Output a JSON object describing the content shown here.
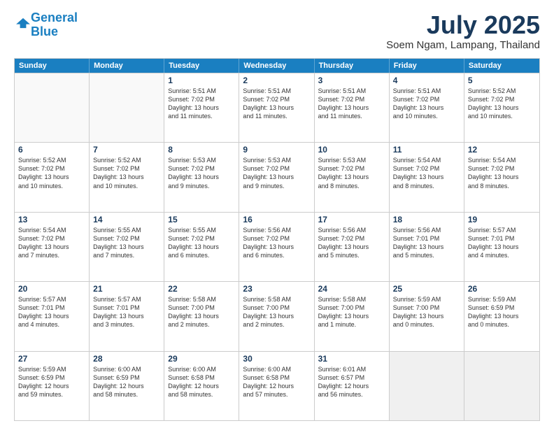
{
  "logo": {
    "line1": "General",
    "line2": "Blue"
  },
  "title": "July 2025",
  "location": "Soem Ngam, Lampang, Thailand",
  "days_of_week": [
    "Sunday",
    "Monday",
    "Tuesday",
    "Wednesday",
    "Thursday",
    "Friday",
    "Saturday"
  ],
  "weeks": [
    [
      {
        "day": "",
        "lines": []
      },
      {
        "day": "",
        "lines": []
      },
      {
        "day": "1",
        "lines": [
          "Sunrise: 5:51 AM",
          "Sunset: 7:02 PM",
          "Daylight: 13 hours",
          "and 11 minutes."
        ]
      },
      {
        "day": "2",
        "lines": [
          "Sunrise: 5:51 AM",
          "Sunset: 7:02 PM",
          "Daylight: 13 hours",
          "and 11 minutes."
        ]
      },
      {
        "day": "3",
        "lines": [
          "Sunrise: 5:51 AM",
          "Sunset: 7:02 PM",
          "Daylight: 13 hours",
          "and 11 minutes."
        ]
      },
      {
        "day": "4",
        "lines": [
          "Sunrise: 5:51 AM",
          "Sunset: 7:02 PM",
          "Daylight: 13 hours",
          "and 10 minutes."
        ]
      },
      {
        "day": "5",
        "lines": [
          "Sunrise: 5:52 AM",
          "Sunset: 7:02 PM",
          "Daylight: 13 hours",
          "and 10 minutes."
        ]
      }
    ],
    [
      {
        "day": "6",
        "lines": [
          "Sunrise: 5:52 AM",
          "Sunset: 7:02 PM",
          "Daylight: 13 hours",
          "and 10 minutes."
        ]
      },
      {
        "day": "7",
        "lines": [
          "Sunrise: 5:52 AM",
          "Sunset: 7:02 PM",
          "Daylight: 13 hours",
          "and 10 minutes."
        ]
      },
      {
        "day": "8",
        "lines": [
          "Sunrise: 5:53 AM",
          "Sunset: 7:02 PM",
          "Daylight: 13 hours",
          "and 9 minutes."
        ]
      },
      {
        "day": "9",
        "lines": [
          "Sunrise: 5:53 AM",
          "Sunset: 7:02 PM",
          "Daylight: 13 hours",
          "and 9 minutes."
        ]
      },
      {
        "day": "10",
        "lines": [
          "Sunrise: 5:53 AM",
          "Sunset: 7:02 PM",
          "Daylight: 13 hours",
          "and 8 minutes."
        ]
      },
      {
        "day": "11",
        "lines": [
          "Sunrise: 5:54 AM",
          "Sunset: 7:02 PM",
          "Daylight: 13 hours",
          "and 8 minutes."
        ]
      },
      {
        "day": "12",
        "lines": [
          "Sunrise: 5:54 AM",
          "Sunset: 7:02 PM",
          "Daylight: 13 hours",
          "and 8 minutes."
        ]
      }
    ],
    [
      {
        "day": "13",
        "lines": [
          "Sunrise: 5:54 AM",
          "Sunset: 7:02 PM",
          "Daylight: 13 hours",
          "and 7 minutes."
        ]
      },
      {
        "day": "14",
        "lines": [
          "Sunrise: 5:55 AM",
          "Sunset: 7:02 PM",
          "Daylight: 13 hours",
          "and 7 minutes."
        ]
      },
      {
        "day": "15",
        "lines": [
          "Sunrise: 5:55 AM",
          "Sunset: 7:02 PM",
          "Daylight: 13 hours",
          "and 6 minutes."
        ]
      },
      {
        "day": "16",
        "lines": [
          "Sunrise: 5:56 AM",
          "Sunset: 7:02 PM",
          "Daylight: 13 hours",
          "and 6 minutes."
        ]
      },
      {
        "day": "17",
        "lines": [
          "Sunrise: 5:56 AM",
          "Sunset: 7:02 PM",
          "Daylight: 13 hours",
          "and 5 minutes."
        ]
      },
      {
        "day": "18",
        "lines": [
          "Sunrise: 5:56 AM",
          "Sunset: 7:01 PM",
          "Daylight: 13 hours",
          "and 5 minutes."
        ]
      },
      {
        "day": "19",
        "lines": [
          "Sunrise: 5:57 AM",
          "Sunset: 7:01 PM",
          "Daylight: 13 hours",
          "and 4 minutes."
        ]
      }
    ],
    [
      {
        "day": "20",
        "lines": [
          "Sunrise: 5:57 AM",
          "Sunset: 7:01 PM",
          "Daylight: 13 hours",
          "and 4 minutes."
        ]
      },
      {
        "day": "21",
        "lines": [
          "Sunrise: 5:57 AM",
          "Sunset: 7:01 PM",
          "Daylight: 13 hours",
          "and 3 minutes."
        ]
      },
      {
        "day": "22",
        "lines": [
          "Sunrise: 5:58 AM",
          "Sunset: 7:00 PM",
          "Daylight: 13 hours",
          "and 2 minutes."
        ]
      },
      {
        "day": "23",
        "lines": [
          "Sunrise: 5:58 AM",
          "Sunset: 7:00 PM",
          "Daylight: 13 hours",
          "and 2 minutes."
        ]
      },
      {
        "day": "24",
        "lines": [
          "Sunrise: 5:58 AM",
          "Sunset: 7:00 PM",
          "Daylight: 13 hours",
          "and 1 minute."
        ]
      },
      {
        "day": "25",
        "lines": [
          "Sunrise: 5:59 AM",
          "Sunset: 7:00 PM",
          "Daylight: 13 hours",
          "and 0 minutes."
        ]
      },
      {
        "day": "26",
        "lines": [
          "Sunrise: 5:59 AM",
          "Sunset: 6:59 PM",
          "Daylight: 13 hours",
          "and 0 minutes."
        ]
      }
    ],
    [
      {
        "day": "27",
        "lines": [
          "Sunrise: 5:59 AM",
          "Sunset: 6:59 PM",
          "Daylight: 12 hours",
          "and 59 minutes."
        ]
      },
      {
        "day": "28",
        "lines": [
          "Sunrise: 6:00 AM",
          "Sunset: 6:59 PM",
          "Daylight: 12 hours",
          "and 58 minutes."
        ]
      },
      {
        "day": "29",
        "lines": [
          "Sunrise: 6:00 AM",
          "Sunset: 6:58 PM",
          "Daylight: 12 hours",
          "and 58 minutes."
        ]
      },
      {
        "day": "30",
        "lines": [
          "Sunrise: 6:00 AM",
          "Sunset: 6:58 PM",
          "Daylight: 12 hours",
          "and 57 minutes."
        ]
      },
      {
        "day": "31",
        "lines": [
          "Sunrise: 6:01 AM",
          "Sunset: 6:57 PM",
          "Daylight: 12 hours",
          "and 56 minutes."
        ]
      },
      {
        "day": "",
        "lines": []
      },
      {
        "day": "",
        "lines": []
      }
    ]
  ]
}
